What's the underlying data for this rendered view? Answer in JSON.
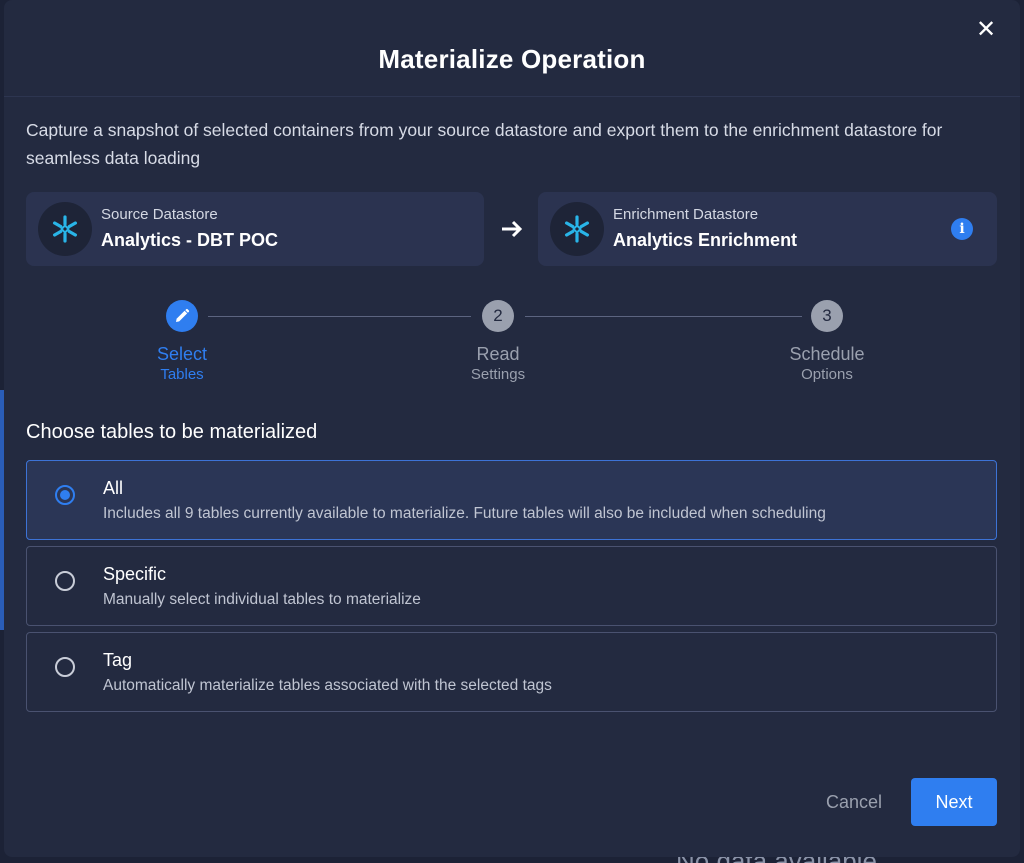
{
  "dialog": {
    "title": "Materialize Operation",
    "close_icon": "close-icon",
    "description": "Capture a snapshot of selected containers from your source datastore and export them to the enrichment datastore for seamless data loading"
  },
  "datastores": {
    "source": {
      "label": "Source Datastore",
      "name": "Analytics - DBT POC",
      "icon": "snowflake-icon"
    },
    "enrichment": {
      "label": "Enrichment Datastore",
      "name": "Analytics Enrichment",
      "icon": "snowflake-icon"
    },
    "arrow_icon": "arrow-right-icon",
    "info_icon": "info-icon",
    "info_glyph": "i"
  },
  "stepper": {
    "steps": [
      {
        "title": "Select",
        "subtitle": "Tables",
        "marker": "pencil-icon",
        "active": true
      },
      {
        "title": "Read",
        "subtitle": "Settings",
        "marker": "2",
        "active": false
      },
      {
        "title": "Schedule",
        "subtitle": "Options",
        "marker": "3",
        "active": false
      }
    ]
  },
  "table_selection": {
    "heading": "Choose tables to be materialized",
    "options": [
      {
        "label": "All",
        "description": "Includes all 9 tables currently available to materialize. Future tables will also be included when scheduling",
        "selected": true
      },
      {
        "label": "Specific",
        "description": "Manually select individual tables to materialize",
        "selected": false
      },
      {
        "label": "Tag",
        "description": "Automatically materialize tables associated with the selected tags",
        "selected": false
      }
    ]
  },
  "actions": {
    "cancel_label": "Cancel",
    "next_label": "Next"
  },
  "background": {
    "partial_text": "No data available"
  },
  "colors": {
    "accent": "#2f7ef0",
    "snowflake": "#29b5e8",
    "modal_bg": "#232a40",
    "card_bg": "#2b3350"
  }
}
